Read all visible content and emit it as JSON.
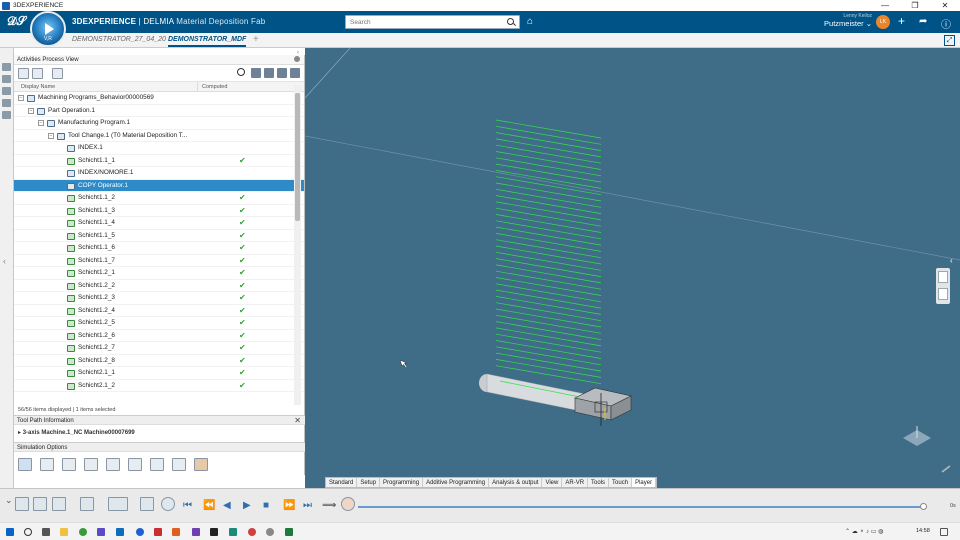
{
  "window": {
    "title": "3DEXPERIENCE",
    "controls": [
      "—",
      "❐",
      "✕"
    ]
  },
  "header": {
    "brand_bold": "3DEXPERIENCE",
    "brand_sep": " | DELMIA ",
    "app_name": "Material Deposition Fab",
    "search_placeholder": "Search",
    "user_name": "Lenny Keiloz",
    "org": "Putzmeister",
    "avatar_initials": "LK"
  },
  "tabs": [
    {
      "label": "DEMONSTRATOR_27_04_20",
      "active": false
    },
    {
      "label": "DEMONSTRATOR_MDF",
      "active": true
    }
  ],
  "panel": {
    "title": "Activities Process View",
    "col_display": "Display Name",
    "col_computed": "Computed",
    "rows": [
      {
        "label": "Machining Programs_Behavior00000569",
        "level": 0,
        "computed": false,
        "toggle": "−",
        "selected": false
      },
      {
        "label": "Part Operation.1",
        "level": 1,
        "computed": false,
        "toggle": "−",
        "selected": false
      },
      {
        "label": "Manufacturing Program.1",
        "level": 2,
        "computed": false,
        "toggle": "−",
        "selected": false
      },
      {
        "label": "Tool Change.1 (T0 Material Deposition T...",
        "level": 3,
        "computed": false,
        "toggle": "−",
        "selected": false
      },
      {
        "label": "INDEX.1",
        "level": 4,
        "computed": false,
        "toggle": "",
        "selected": false
      },
      {
        "label": "Schicht1.1_1",
        "level": 4,
        "computed": true,
        "toggle": "",
        "selected": false
      },
      {
        "label": "INDEX/NOMORE.1",
        "level": 4,
        "computed": false,
        "toggle": "",
        "selected": false
      },
      {
        "label": "COPY Operator.1",
        "level": 4,
        "computed": false,
        "toggle": "",
        "selected": true
      },
      {
        "label": "Schicht1.1_2",
        "level": 4,
        "computed": true,
        "toggle": "",
        "selected": false
      },
      {
        "label": "Schicht1.1_3",
        "level": 4,
        "computed": true,
        "toggle": "",
        "selected": false
      },
      {
        "label": "Schicht1.1_4",
        "level": 4,
        "computed": true,
        "toggle": "",
        "selected": false
      },
      {
        "label": "Schicht1.1_5",
        "level": 4,
        "computed": true,
        "toggle": "",
        "selected": false
      },
      {
        "label": "Schicht1.1_6",
        "level": 4,
        "computed": true,
        "toggle": "",
        "selected": false
      },
      {
        "label": "Schicht1.1_7",
        "level": 4,
        "computed": true,
        "toggle": "",
        "selected": false
      },
      {
        "label": "Schicht1.2_1",
        "level": 4,
        "computed": true,
        "toggle": "",
        "selected": false
      },
      {
        "label": "Schicht1.2_2",
        "level": 4,
        "computed": true,
        "toggle": "",
        "selected": false
      },
      {
        "label": "Schicht1.2_3",
        "level": 4,
        "computed": true,
        "toggle": "",
        "selected": false
      },
      {
        "label": "Schicht1.2_4",
        "level": 4,
        "computed": true,
        "toggle": "",
        "selected": false
      },
      {
        "label": "Schicht1.2_5",
        "level": 4,
        "computed": true,
        "toggle": "",
        "selected": false
      },
      {
        "label": "Schicht1.2_6",
        "level": 4,
        "computed": true,
        "toggle": "",
        "selected": false
      },
      {
        "label": "Schicht1.2_7",
        "level": 4,
        "computed": true,
        "toggle": "",
        "selected": false
      },
      {
        "label": "Schicht1.2_8",
        "level": 4,
        "computed": true,
        "toggle": "",
        "selected": false
      },
      {
        "label": "Schicht2.1_1",
        "level": 4,
        "computed": true,
        "toggle": "",
        "selected": false
      },
      {
        "label": "Schicht2.1_2",
        "level": 4,
        "computed": true,
        "toggle": "",
        "selected": false
      }
    ],
    "status": "56/56 items displayed | 1 items selected",
    "toolpath_title": "Tool Path Information",
    "machine_label": "3-axis Machine.1_NC Machine00007699",
    "sim_options_title": "Simulation Options"
  },
  "action_tabs": [
    "Standard",
    "Setup",
    "Programming",
    "Additive Programming",
    "Analysis & output",
    "View",
    "AR-VR",
    "Tools",
    "Touch",
    "Player"
  ],
  "active_action_tab": "Player",
  "player": {
    "time_label": "0s",
    "progress": 1.0
  },
  "taskbar": {
    "time": "14:58"
  },
  "colors": {
    "header": "#005386",
    "viewport": "#3f6c86",
    "toolpath": "#35e04a",
    "selection": "#2e8bc8"
  }
}
